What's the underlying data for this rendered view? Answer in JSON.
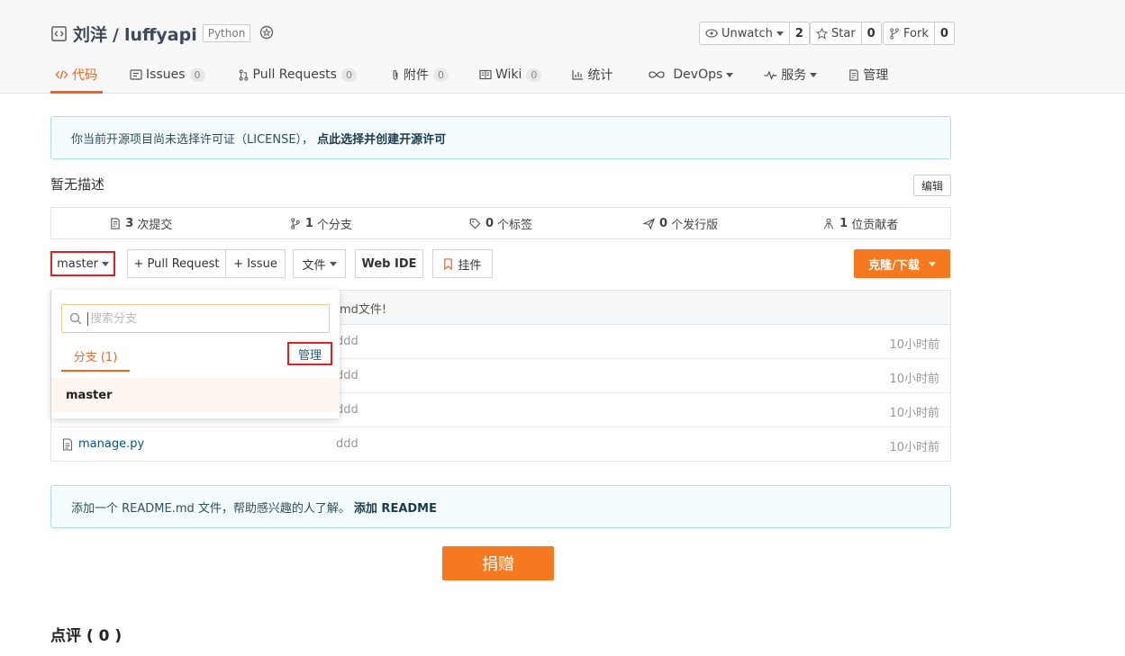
{
  "repo": {
    "owner": "刘洋",
    "separator": "/",
    "name": "luffyapi",
    "language": "Python"
  },
  "actions": [
    {
      "label": "Unwatch",
      "count": "2",
      "icon": "eye-icon"
    },
    {
      "label": "Star",
      "count": "0",
      "icon": "star-icon"
    },
    {
      "label": "Fork",
      "count": "0",
      "icon": "fork-icon"
    }
  ],
  "tabs": [
    {
      "label": "代码",
      "icon": "code-icon",
      "active": true
    },
    {
      "label": "Issues",
      "count": "0",
      "icon": "issues-icon"
    },
    {
      "label": "Pull Requests",
      "count": "0",
      "icon": "pull-request-icon"
    },
    {
      "label": "附件",
      "count": "0",
      "icon": "paperclip-icon"
    },
    {
      "label": "Wiki",
      "count": "0",
      "icon": "book-icon"
    },
    {
      "label": "统计",
      "icon": "bar-chart-icon"
    },
    {
      "label": "DevOps",
      "icon": "infinity-icon"
    },
    {
      "label": "服务",
      "icon": "pulse-icon"
    },
    {
      "label": "管理",
      "icon": "settings-doc-icon"
    }
  ],
  "license_notice": {
    "text": "你当前开源项目尚未选择许可证（LICENSE），",
    "link": "点此选择并创建开源许可"
  },
  "description": "暂无描述",
  "edit_label": "编辑",
  "stats": [
    {
      "count": "3",
      "label": "次提交",
      "icon": "commit-icon"
    },
    {
      "count": "1",
      "label": "个分支",
      "icon": "branch-icon"
    },
    {
      "count": "0",
      "label": "个标签",
      "icon": "tag-icon"
    },
    {
      "count": "0",
      "label": "个发行版",
      "icon": "release-icon"
    },
    {
      "count": "1",
      "label": "位贡献者",
      "icon": "contributors-icon"
    }
  ],
  "toolbar": {
    "branch": "master",
    "pull_request": "+ Pull Request",
    "issue": "+ Issue",
    "file": "文件",
    "web_ide": "Web IDE",
    "widget": "挂件",
    "clone": "克隆/下载"
  },
  "files": {
    "last_commit_msg": "md文件!",
    "rows": [
      {
        "name": "",
        "message": "ddd",
        "time": "10小时前"
      },
      {
        "name": "",
        "message": "ddd",
        "time": "10小时前"
      },
      {
        "name": "",
        "message": "ddd",
        "time": "10小时前"
      },
      {
        "name": "manage.py",
        "message": "ddd",
        "time": "10小时前"
      }
    ]
  },
  "branch_dropdown": {
    "search_placeholder": "搜索分支",
    "tab_label": "分支 (1)",
    "manage_label": "管理",
    "branches": [
      "master"
    ]
  },
  "readme_notice": {
    "text": "添加一个 README.md 文件，帮助感兴趣的人了解。",
    "link": "添加 README"
  },
  "donate_label": "捐赠",
  "comments_title": "点评 ( 0 )",
  "colors": {
    "accent": "#f1661f",
    "clone_button": "#f6781f",
    "highlight_border": "#e02020",
    "notice_border": "#a9dfe9"
  }
}
